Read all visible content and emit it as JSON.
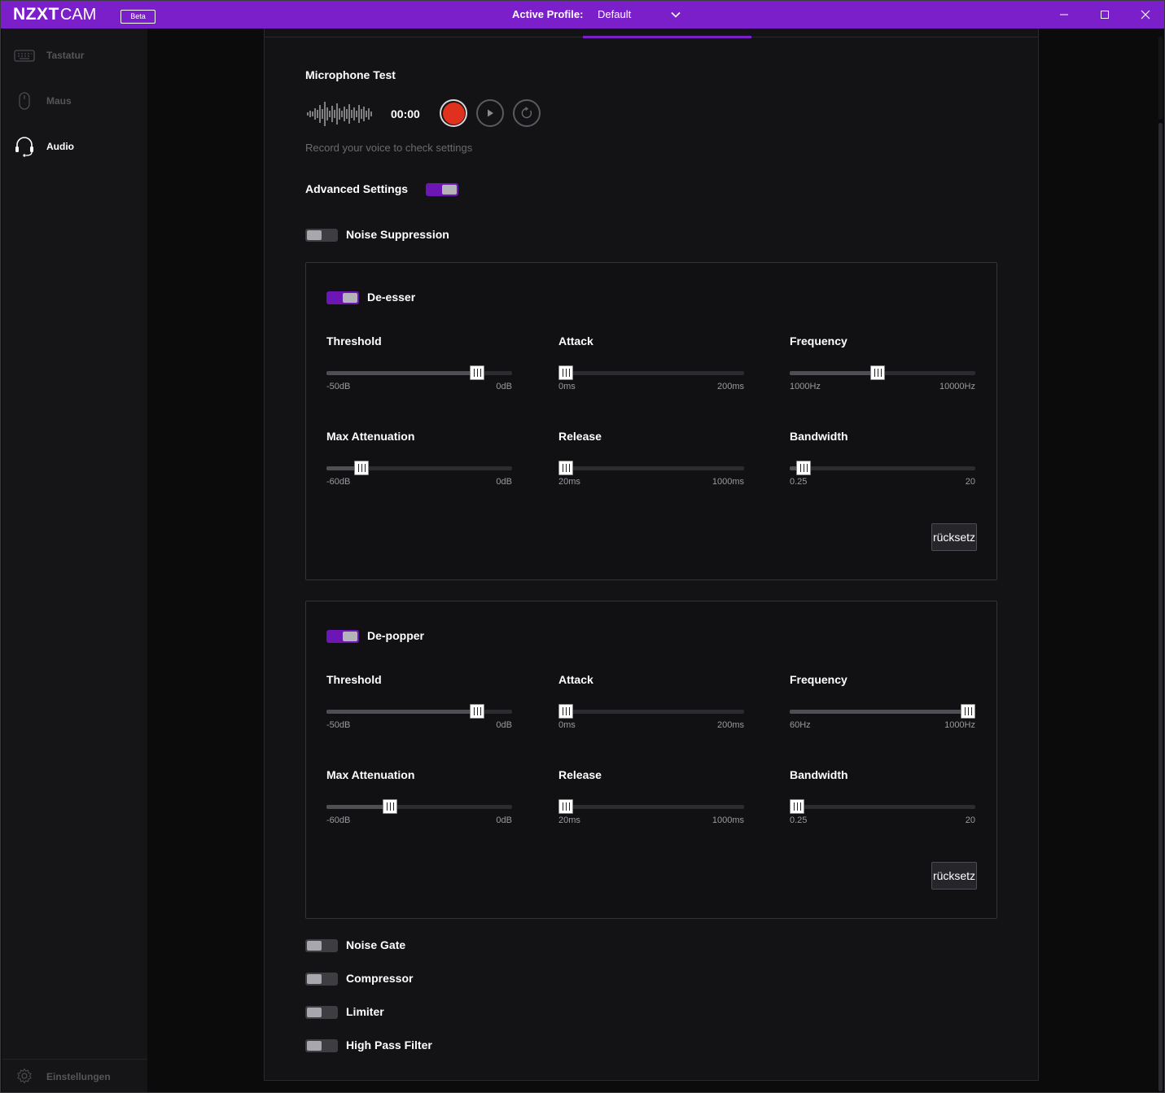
{
  "titlebar": {
    "logo_main": "NZXT",
    "logo_sub": "CAM",
    "beta_badge": "Beta",
    "profile_label": "Active Profile:",
    "profile_value": "Default",
    "accent_color": "#7a1fc9"
  },
  "sidebar": {
    "items": [
      {
        "label": "Tastatur",
        "icon": "keyboard-icon",
        "active": false
      },
      {
        "label": "Maus",
        "icon": "mouse-icon",
        "active": false
      },
      {
        "label": "Audio",
        "icon": "headset-icon",
        "active": true
      }
    ],
    "settings_label": "Einstellungen",
    "settings_icon": "gear-icon"
  },
  "mic_test": {
    "title": "Microphone Test",
    "timer": "00:00",
    "hint": "Record your voice to check settings",
    "record_color": "#e0301e"
  },
  "advanced": {
    "label": "Advanced Settings",
    "enabled": true
  },
  "noise_suppression": {
    "label": "Noise Suppression",
    "enabled": false
  },
  "effects": [
    {
      "name": "De-esser",
      "enabled": true,
      "reset_label": "rücksetz",
      "sliders": [
        {
          "title": "Threshold",
          "min": "-50dB",
          "max": "0dB",
          "level": 0.84
        },
        {
          "title": "Attack",
          "min": "0ms",
          "max": "200ms",
          "level": 0.0
        },
        {
          "title": "Frequency",
          "min": "1000Hz",
          "max": "10000Hz",
          "level": 0.47
        },
        {
          "title": "Max Attenuation",
          "min": "-60dB",
          "max": "0dB",
          "level": 0.16
        },
        {
          "title": "Release",
          "min": "20ms",
          "max": "1000ms",
          "level": 0.0
        },
        {
          "title": "Bandwidth",
          "min": "0.25",
          "max": "20",
          "level": 0.04
        }
      ]
    },
    {
      "name": "De-popper",
      "enabled": true,
      "reset_label": "rücksetz",
      "sliders": [
        {
          "title": "Threshold",
          "min": "-50dB",
          "max": "0dB",
          "level": 0.84
        },
        {
          "title": "Attack",
          "min": "0ms",
          "max": "200ms",
          "level": 0.0
        },
        {
          "title": "Frequency",
          "min": "60Hz",
          "max": "1000Hz",
          "level": 1.0
        },
        {
          "title": "Max Attenuation",
          "min": "-60dB",
          "max": "0dB",
          "level": 0.33
        },
        {
          "title": "Release",
          "min": "20ms",
          "max": "1000ms",
          "level": 0.0
        },
        {
          "title": "Bandwidth",
          "min": "0.25",
          "max": "20",
          "level": 0.0
        }
      ]
    }
  ],
  "other_filters": [
    {
      "label": "Noise Gate",
      "enabled": false
    },
    {
      "label": "Compressor",
      "enabled": false
    },
    {
      "label": "Limiter",
      "enabled": false
    },
    {
      "label": "High Pass Filter",
      "enabled": false
    }
  ]
}
